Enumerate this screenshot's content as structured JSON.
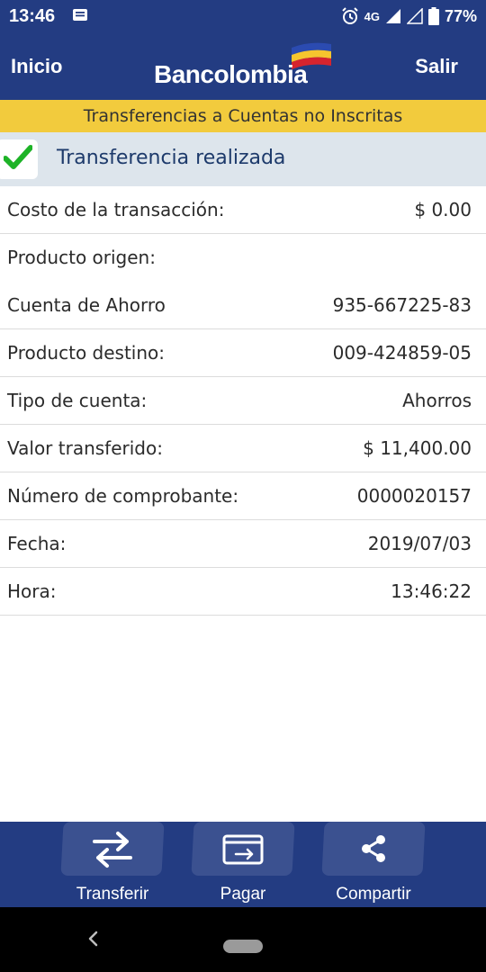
{
  "status_bar": {
    "time": "13:46",
    "network": "4G",
    "battery": "77%",
    "icons": [
      "message-icon",
      "alarm-icon",
      "signal-icon",
      "signal-empty-icon",
      "battery-icon"
    ]
  },
  "header": {
    "left_label": "Inicio",
    "brand": "Bancolombia",
    "right_label": "Salir",
    "colors": {
      "bar": "#233c82",
      "logo_yellow": "#f6c52e",
      "logo_red": "#d6242e",
      "logo_blue": "#2b4bb1"
    }
  },
  "banner": {
    "title": "Transferencias a Cuentas no Inscritas",
    "color": "#f2cb3d"
  },
  "result": {
    "message": "Transferencia realizada",
    "icon": "check-icon",
    "check_color": "#1db327"
  },
  "details": [
    {
      "label": "Costo de la transacción:",
      "value": "$ 0.00"
    },
    {
      "label": "Producto origen:",
      "value": ""
    },
    {
      "label": "Cuenta de Ahorro",
      "value": "935-667225-83"
    },
    {
      "label": "Producto destino:",
      "value": "009-424859-05"
    },
    {
      "label": "Tipo de cuenta:",
      "value": "Ahorros"
    },
    {
      "label": "Valor transferido:",
      "value": "$ 11,400.00"
    },
    {
      "label": "Número de comprobante:",
      "value": "0000020157"
    },
    {
      "label": "Fecha:",
      "value": "2019/07/03"
    },
    {
      "label": "Hora:",
      "value": "13:46:22"
    }
  ],
  "actions": [
    {
      "label": "Transferir",
      "icon": "transfer-arrows-icon"
    },
    {
      "label": "Pagar",
      "icon": "card-payment-icon"
    },
    {
      "label": "Compartir",
      "icon": "share-icon"
    }
  ],
  "nav": {
    "icons": [
      "back-icon",
      "home-pill-icon"
    ]
  }
}
